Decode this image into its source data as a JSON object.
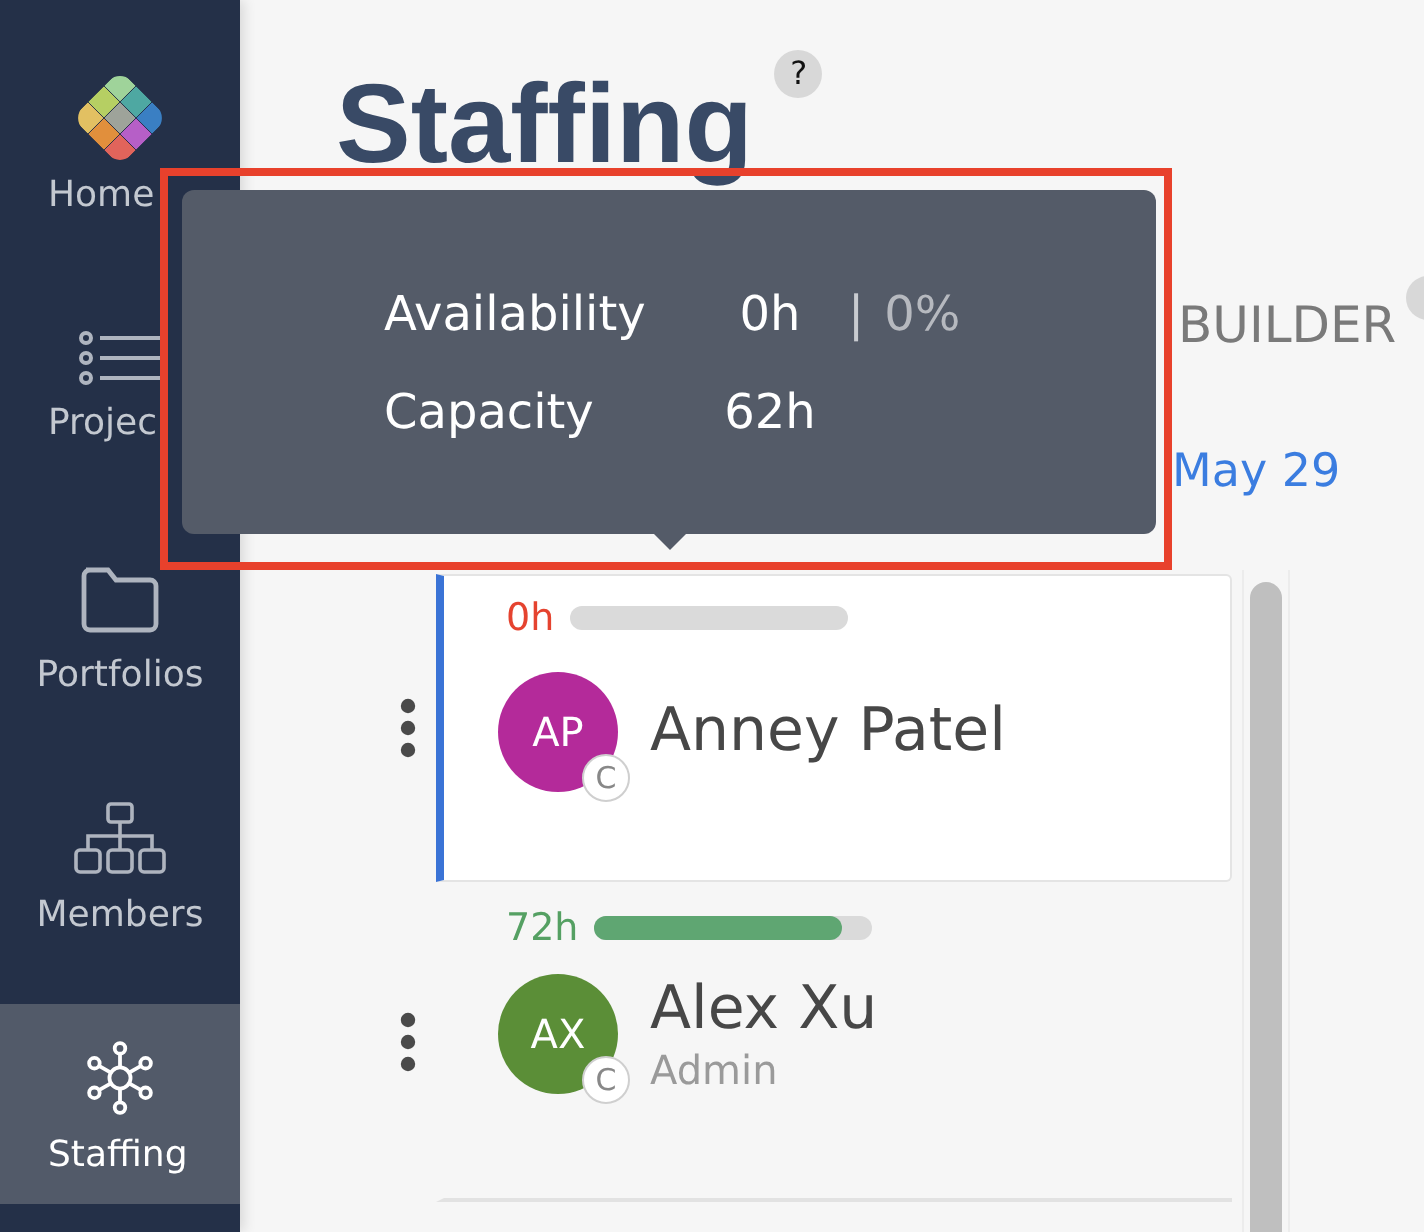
{
  "sidebar": {
    "items": [
      {
        "label": "Home",
        "kind": "logo",
        "selected": false
      },
      {
        "label": "Projec",
        "kind": "list",
        "selected": false
      },
      {
        "label": "Portfolios",
        "kind": "folder",
        "selected": false
      },
      {
        "label": "Members",
        "kind": "org",
        "selected": false
      },
      {
        "label": "Staffing",
        "kind": "network",
        "selected": true
      }
    ]
  },
  "header": {
    "title": "Staffing",
    "help": "?",
    "section_label": "BUILDER",
    "date": "May 29"
  },
  "members": [
    {
      "hours": "0h",
      "level": 0,
      "initials": "AP",
      "color": "#b42a9a",
      "badge": "C",
      "name": "Anney Patel",
      "selected": true
    },
    {
      "hours": "72h",
      "level": 0.89,
      "initials": "AX",
      "color": "#5b8e37",
      "badge": "C",
      "name": "Alex Xu",
      "role": "Admin",
      "selected": false
    }
  ],
  "tooltip": {
    "rows": [
      {
        "label": "Availability",
        "value": "0h",
        "separator": "|",
        "percent": "0%"
      },
      {
        "label": "Capacity",
        "value": "62h"
      }
    ]
  }
}
